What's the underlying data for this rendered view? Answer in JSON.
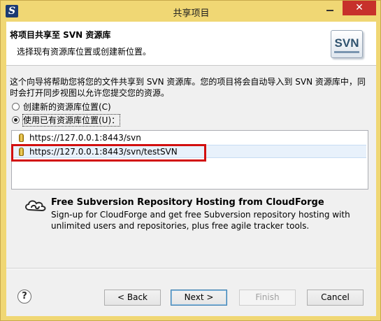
{
  "window": {
    "title": "共享项目",
    "app_icon": "S",
    "close_glyph": "✕"
  },
  "header": {
    "title": "将项目共享至 SVN 资源库",
    "subtitle": "选择现有资源库位置或创建新位置。",
    "logo_text": "SVN"
  },
  "description": "这个向导将帮助您将您的文件共享到 SVN 资源库。您的项目将会自动导入到 SVN 资源库中，同时会打开同步视图以允许您提交您的资源。",
  "options": {
    "create_new_label": "创建新的资源库位置(C)",
    "use_existing_label": "使用已有资源库位置(U)：",
    "selected": "use_existing"
  },
  "repositories": [
    {
      "url": "https://127.0.0.1:8443/svn"
    },
    {
      "url": "https://127.0.0.1:8443/svn/testSVN"
    }
  ],
  "cloudforge": {
    "title": "Free Subversion Repository Hosting from CloudForge",
    "text": "Sign-up for CloudForge and get free Subversion repository hosting with unlimited users and repositories, plus free agile tracker tools."
  },
  "buttons": {
    "help": "?",
    "back": "< Back",
    "next": "Next >",
    "finish": "Finish",
    "cancel": "Cancel"
  },
  "colors": {
    "frame": "#f0d774",
    "close_button": "#c7312b",
    "highlight_box": "#d20f0f",
    "selection": "#e8f1fb"
  }
}
